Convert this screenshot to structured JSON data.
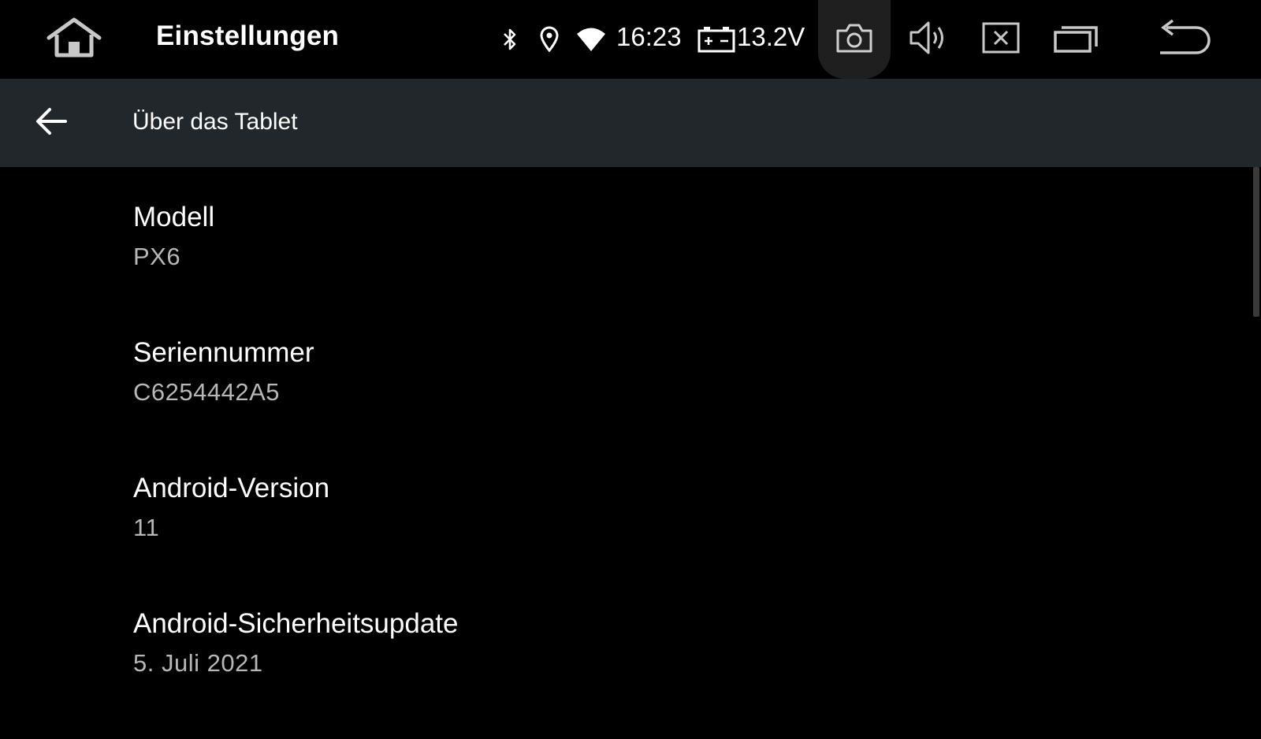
{
  "status_bar": {
    "app_title": "Einstellungen",
    "time": "16:23",
    "voltage": "13.2V",
    "icons": [
      "home-icon",
      "bluetooth-icon",
      "location-icon",
      "wifi-icon",
      "battery-icon",
      "camera-icon",
      "volume-icon",
      "close-app-icon",
      "recent-apps-icon",
      "back-icon"
    ]
  },
  "toolbar": {
    "title": "Über das Tablet",
    "back_icon": "arrow-left-icon"
  },
  "preferences": [
    {
      "title": "Modell",
      "summary": "PX6"
    },
    {
      "title": "Seriennummer",
      "summary": "C6254442A5"
    },
    {
      "title": "Android-Version",
      "summary": "11"
    },
    {
      "title": "Android-Sicherheitsupdate",
      "summary": "5. Juli 2021"
    }
  ],
  "colors": {
    "background": "#000000",
    "toolbar": "#22272b",
    "summary_text": "#b7b7b7",
    "camera_highlight": "#1f1f1f"
  }
}
